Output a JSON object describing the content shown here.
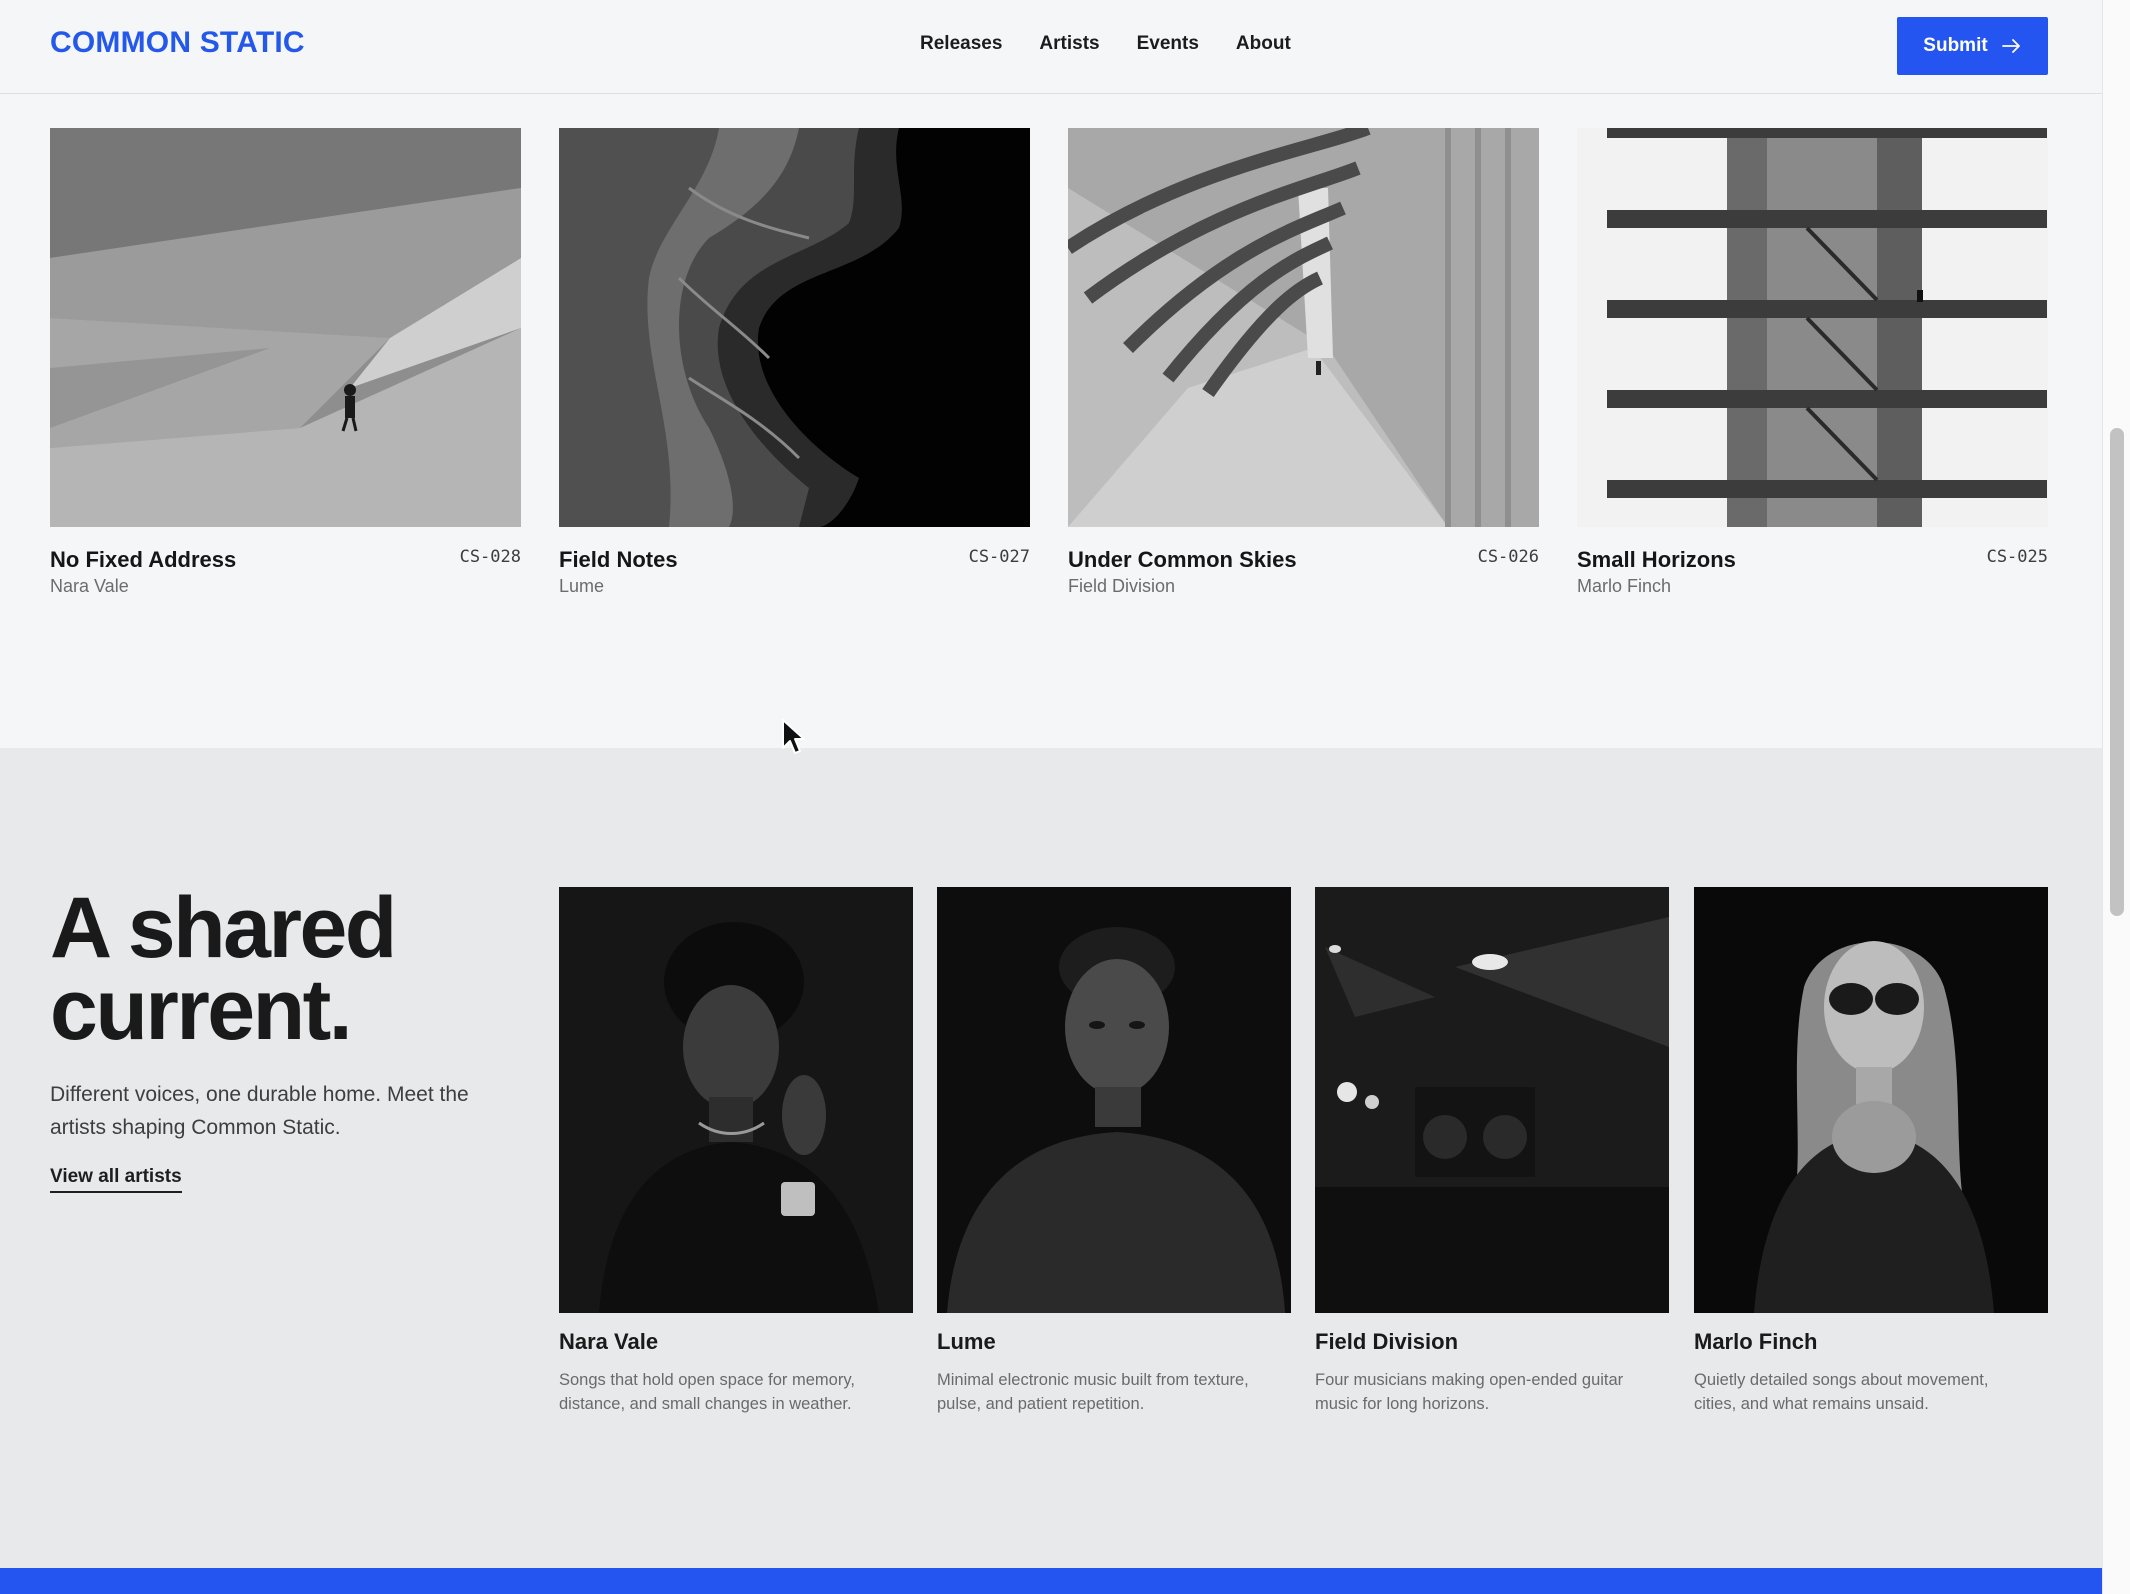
{
  "header": {
    "logo": "COMMON STATIC",
    "nav": [
      "Releases",
      "Artists",
      "Events",
      "About"
    ],
    "submit_label": "Submit",
    "submit_icon": "arrow-right-icon"
  },
  "releases": [
    {
      "title": "No Fixed Address",
      "code": "CS-028",
      "artist": "Nara Vale"
    },
    {
      "title": "Field Notes",
      "code": "CS-027",
      "artist": "Lume"
    },
    {
      "title": "Under Common Skies",
      "code": "CS-026",
      "artist": "Field Division"
    },
    {
      "title": "Small Horizons",
      "code": "CS-025",
      "artist": "Marlo Finch"
    }
  ],
  "artists_section": {
    "headline_line1": "A shared",
    "headline_line2": "current.",
    "intro": "Different voices, one durable home. Meet the artists shaping Common Static.",
    "view_all": "View all artists",
    "artists": [
      {
        "name": "Nara Vale",
        "desc": "Songs that hold open space for memory, distance, and small changes in weather."
      },
      {
        "name": "Lume",
        "desc": "Minimal electronic music built from texture, pulse, and patient repetition."
      },
      {
        "name": "Field Division",
        "desc": "Four musicians making open-ended guitar music for long horizons."
      },
      {
        "name": "Marlo Finch",
        "desc": "Quietly detailed songs about movement, cities, and what remains unsaid."
      }
    ]
  },
  "colors": {
    "accent": "#2555f0",
    "logo": "#2358ea",
    "section_bg": "#e8e9eb",
    "page_bg": "#f4f6f8"
  }
}
